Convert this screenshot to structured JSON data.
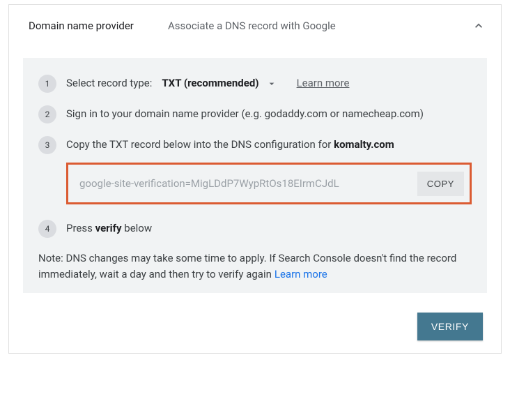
{
  "header": {
    "title": "Domain name provider",
    "subtitle": "Associate a DNS record with Google"
  },
  "steps": {
    "s1": {
      "num": "1",
      "label": "Select record type:",
      "value": "TXT (recommended)",
      "learn": "Learn more"
    },
    "s2": {
      "num": "2",
      "text": "Sign in to your domain name provider (e.g. godaddy.com or namecheap.com)"
    },
    "s3": {
      "num": "3",
      "text_a": "Copy the TXT record below into the DNS configuration for ",
      "domain": "komalty.com",
      "txt_value": "google-site-verification=MigLDdP7WypRtOs18EIrmCJdL",
      "copy": "COPY"
    },
    "s4": {
      "num": "4",
      "text_a": "Press ",
      "bold": "verify",
      "text_b": " below"
    }
  },
  "note": {
    "text": "Note: DNS changes may take some time to apply. If Search Console doesn't find the record immediately, wait a day and then try to verify again",
    "learn": "Learn more"
  },
  "footer": {
    "verify": "VERIFY"
  }
}
